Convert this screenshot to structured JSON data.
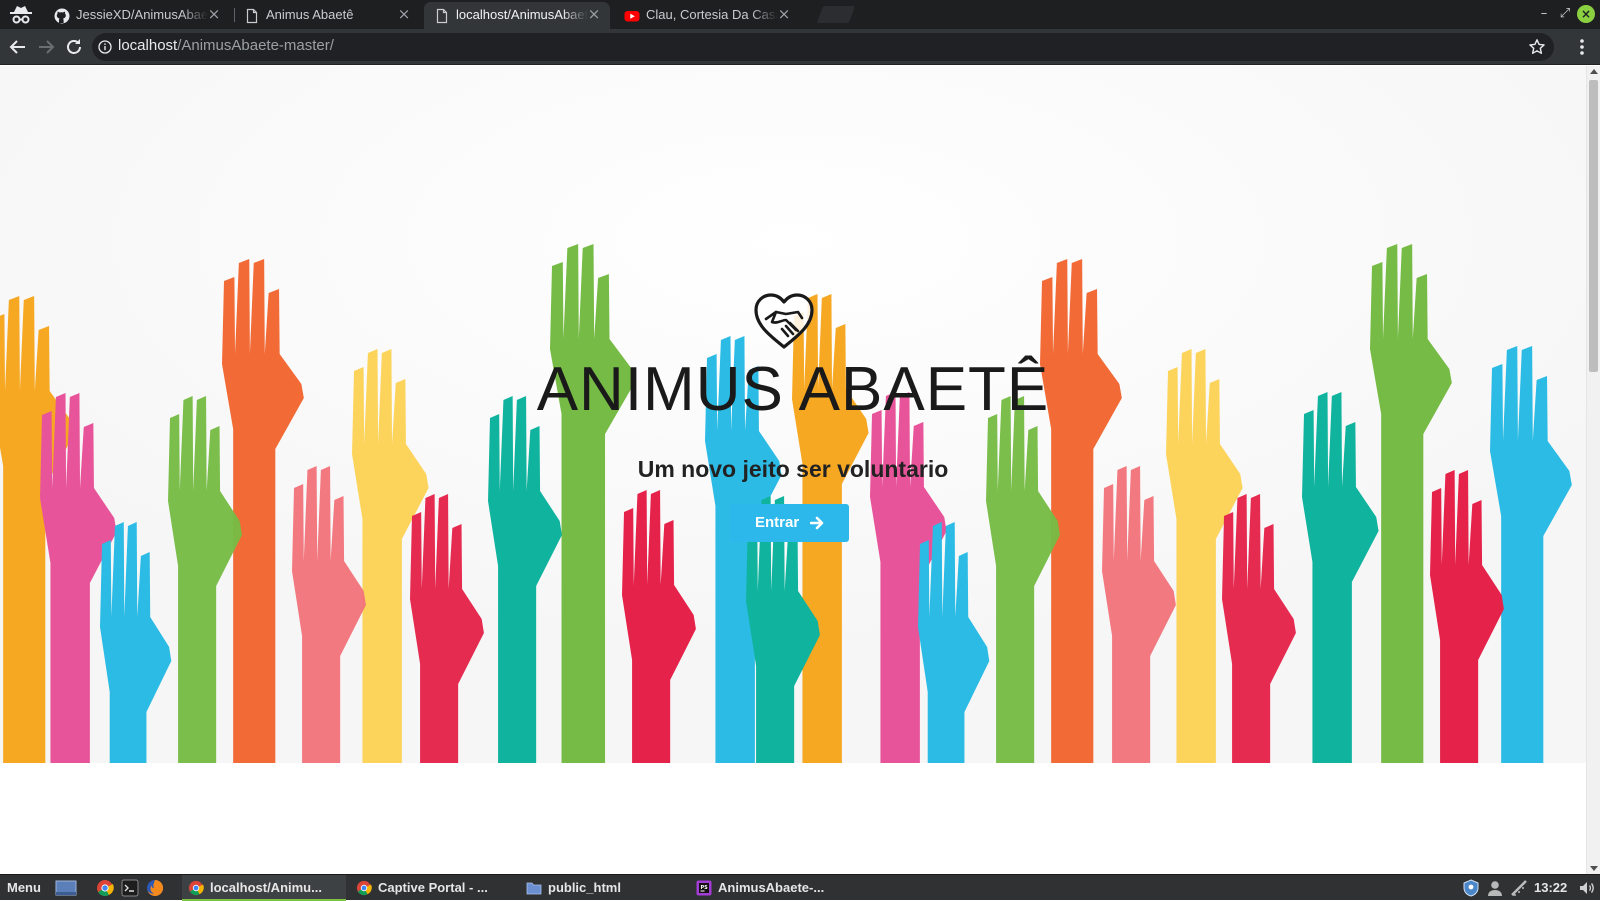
{
  "browser": {
    "tabs": [
      {
        "title": "JessieXD/AnimusAbaetê",
        "favicon": "github-icon",
        "active": false
      },
      {
        "title": "Animus Abaetê",
        "favicon": "page-icon",
        "active": false
      },
      {
        "title": "localhost/AnimusAbaetê",
        "favicon": "page-icon",
        "active": true
      },
      {
        "title": "Clau, Cortesia Da Casa",
        "favicon": "youtube-icon",
        "active": false
      }
    ],
    "tab_close": "×",
    "address": {
      "host": "localhost",
      "path": "/AnimusAbaete-master/"
    },
    "window_controls": {
      "minimize": "–",
      "maximize": "⤢",
      "close": "×"
    }
  },
  "page": {
    "logo_icon": "heart-handshake-icon",
    "title": "ANIMUS ABAETÊ",
    "subtitle": "Um novo jeito ser voluntario",
    "cta_label": "Entrar",
    "cta_icon": "arrow-right-icon",
    "colors": {
      "cta": "#2cb8ea",
      "hands": [
        "#f7a823",
        "#f26a36",
        "#e8549a",
        "#76bb45",
        "#fcd45c",
        "#2bbbe5",
        "#10b39e",
        "#e5224a",
        "#f2727a"
      ]
    }
  },
  "taskbar": {
    "menu_label": "Menu",
    "tasks": [
      {
        "label": "localhost/Animu...",
        "icon": "chrome-icon",
        "active": true
      },
      {
        "label": "Captive Portal - ...",
        "icon": "chrome-icon",
        "active": false
      },
      {
        "label": "public_html",
        "icon": "folder-icon",
        "active": false
      },
      {
        "label": "AnimusAbaete-...",
        "icon": "phpstorm-icon",
        "active": false
      }
    ],
    "clock": "13:22"
  }
}
